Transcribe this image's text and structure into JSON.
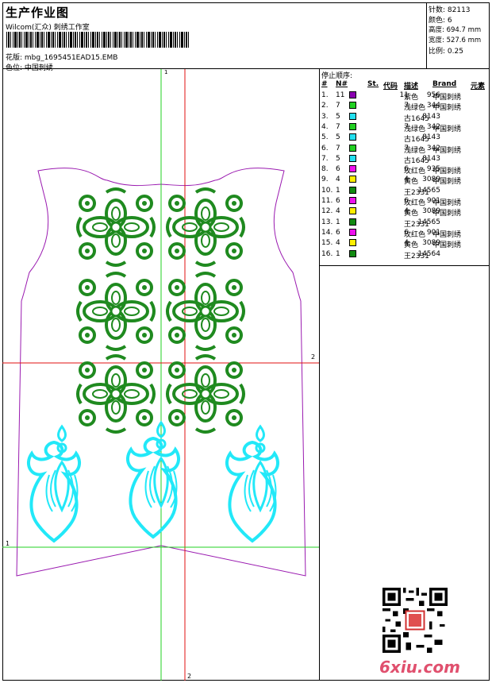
{
  "header": {
    "title": "生产作业图",
    "company": "Wilcom(汇众) 刺绣工作室",
    "design_label": "花版: mbg_1695451EAD15.EMB",
    "color_label": "色位: 中国刺绣"
  },
  "specs": {
    "stitches": "针数: 82113",
    "colors": "颜色: 6",
    "height": "高度: 694.7 mm",
    "width": "宽度: 527.6 mm",
    "scale": "比例: 0.25"
  },
  "canvas": {
    "marker_top": "1",
    "marker_right": "2",
    "marker_left": "1",
    "marker_bottom": "2"
  },
  "stop_sequence": {
    "title": "停止顺序:",
    "headers": {
      "num": "#",
      "n": "N#",
      "st": "St.",
      "code": "代码",
      "desc": "描述",
      "brand": "Brand",
      "element": "元素"
    },
    "rows": [
      {
        "num": "1.",
        "n": "11",
        "color": "#8a00b0",
        "st": "956",
        "code": "11",
        "desc": "紫色",
        "brand": "中国刺绣"
      },
      {
        "num": "2.",
        "n": "7",
        "color": "#22d022",
        "st": "344",
        "code": "7",
        "desc": "浅绿色",
        "brand": "中国刺绣"
      },
      {
        "num": "3.",
        "n": "5",
        "color": "#22e0f0",
        "st": "8143",
        "code": "",
        "desc": "古1645",
        "brand": ""
      },
      {
        "num": "4.",
        "n": "7",
        "color": "#22d022",
        "st": "342",
        "code": "7",
        "desc": "浅绿色",
        "brand": "中国刺绣"
      },
      {
        "num": "5.",
        "n": "5",
        "color": "#22e0f0",
        "st": "8143",
        "code": "",
        "desc": "古1645",
        "brand": ""
      },
      {
        "num": "6.",
        "n": "7",
        "color": "#22d022",
        "st": "342",
        "code": "7",
        "desc": "浅绿色",
        "brand": "中国刺绣"
      },
      {
        "num": "7.",
        "n": "5",
        "color": "#22e0f0",
        "st": "8143",
        "code": "",
        "desc": "古1645",
        "brand": ""
      },
      {
        "num": "8.",
        "n": "6",
        "color": "#ee10ee",
        "st": "935",
        "code": "6",
        "desc": "玫红色",
        "brand": "中国刺绣"
      },
      {
        "num": "9.",
        "n": "4",
        "color": "#ffee00",
        "st": "3089",
        "code": "4",
        "desc": "黄色",
        "brand": "中国刺绣"
      },
      {
        "num": "10.",
        "n": "1",
        "color": "#118a11",
        "st": "14565",
        "code": "",
        "desc": "王2331",
        "brand": ""
      },
      {
        "num": "11.",
        "n": "6",
        "color": "#ee10ee",
        "st": "901",
        "code": "6",
        "desc": "玫红色",
        "brand": "中国刺绣"
      },
      {
        "num": "12.",
        "n": "4",
        "color": "#ffee00",
        "st": "3089",
        "code": "4",
        "desc": "黄色",
        "brand": "中国刺绣"
      },
      {
        "num": "13.",
        "n": "1",
        "color": "#118a11",
        "st": "14565",
        "code": "",
        "desc": "王2331",
        "brand": ""
      },
      {
        "num": "14.",
        "n": "6",
        "color": "#ee10ee",
        "st": "901",
        "code": "6",
        "desc": "玫红色",
        "brand": "中国刺绣"
      },
      {
        "num": "15.",
        "n": "4",
        "color": "#ffee00",
        "st": "3089",
        "code": "4",
        "desc": "黄色",
        "brand": "中国刺绣"
      },
      {
        "num": "16.",
        "n": "1",
        "color": "#118a11",
        "st": "14564",
        "code": "",
        "desc": "王2331",
        "brand": ""
      }
    ]
  },
  "watermark": "6xiu.com",
  "colors": {
    "outline": "#9a1ab0",
    "green": "#1f8a1f",
    "cyan": "#22e8f8",
    "axis_red": "#e01010",
    "axis_green": "#20d020"
  }
}
